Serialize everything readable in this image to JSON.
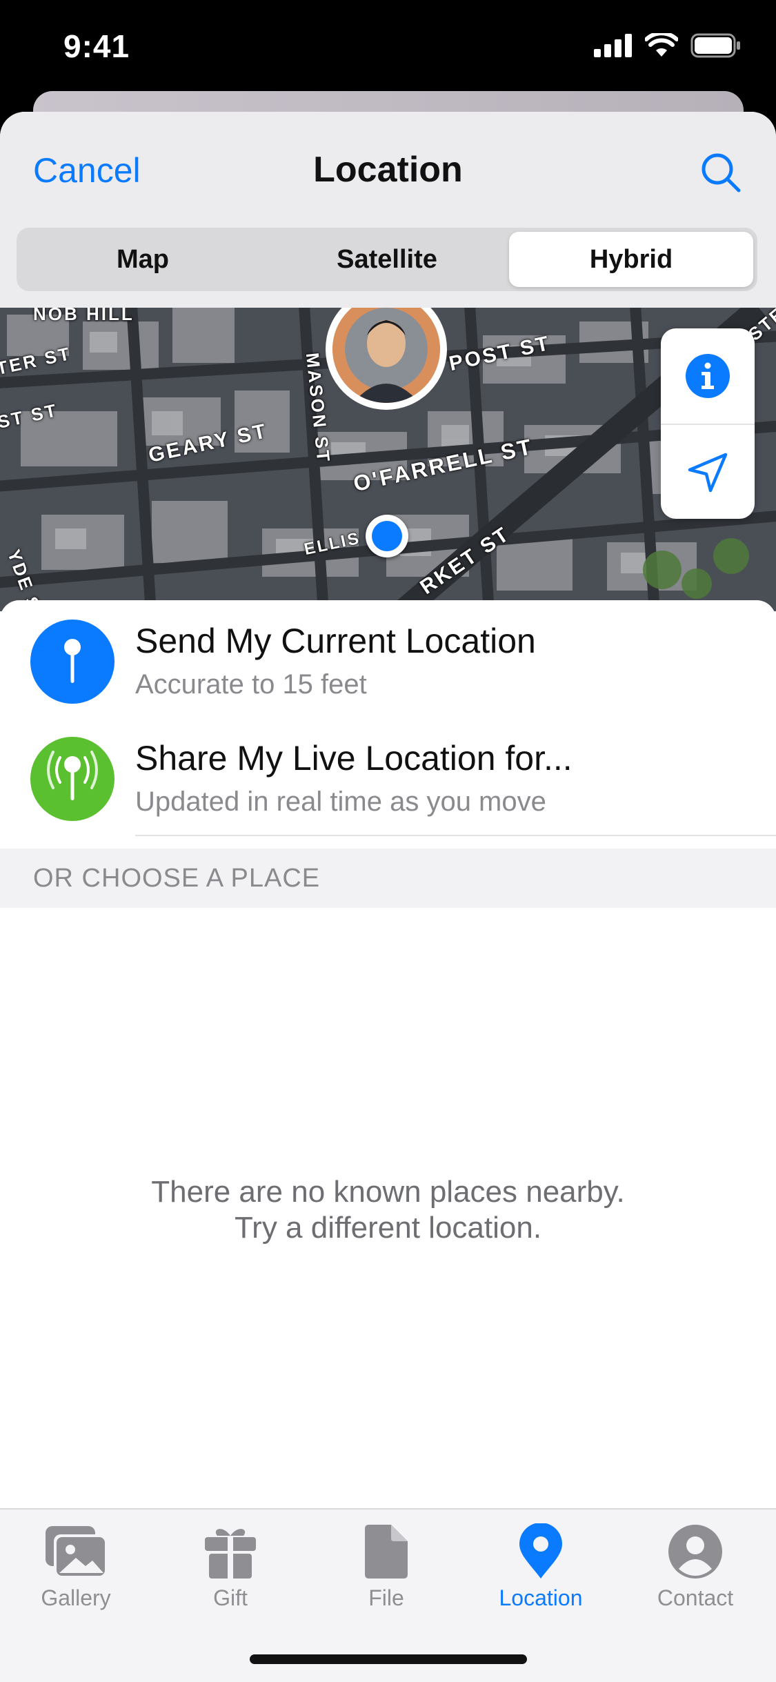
{
  "status_bar": {
    "time": "9:41"
  },
  "nav": {
    "cancel_label": "Cancel",
    "title": "Location"
  },
  "segments": [
    {
      "label": "Map",
      "active": false
    },
    {
      "label": "Satellite",
      "active": false
    },
    {
      "label": "Hybrid",
      "active": true
    }
  ],
  "map": {
    "streets": [
      "NOB HILL",
      "TER ST",
      "ST ST",
      "GEARY ST",
      "MASON ST",
      "POST ST",
      "O'FARRELL ST",
      "ELLIS ST",
      "RKET ST",
      "STE",
      "YDE S"
    ]
  },
  "rows": [
    {
      "title": "Send My Current Location",
      "subtitle": "Accurate to 15 feet",
      "icon_color": "#0a7aff"
    },
    {
      "title": "Share My Live Location for...",
      "subtitle": "Updated in real time as you move",
      "icon_color": "#5ac02f"
    }
  ],
  "section_header": "OR CHOOSE A PLACE",
  "empty_state": {
    "line1": "There are no known places nearby.",
    "line2": "Try a different location."
  },
  "tabs": [
    {
      "label": "Gallery",
      "icon": "gallery-icon",
      "active": false
    },
    {
      "label": "Gift",
      "icon": "gift-icon",
      "active": false
    },
    {
      "label": "File",
      "icon": "file-icon",
      "active": false
    },
    {
      "label": "Location",
      "icon": "location-pin-icon",
      "active": true
    },
    {
      "label": "Contact",
      "icon": "contact-icon",
      "active": false
    }
  ],
  "colors": {
    "accent": "#0a7aff",
    "live": "#5ac02f"
  }
}
